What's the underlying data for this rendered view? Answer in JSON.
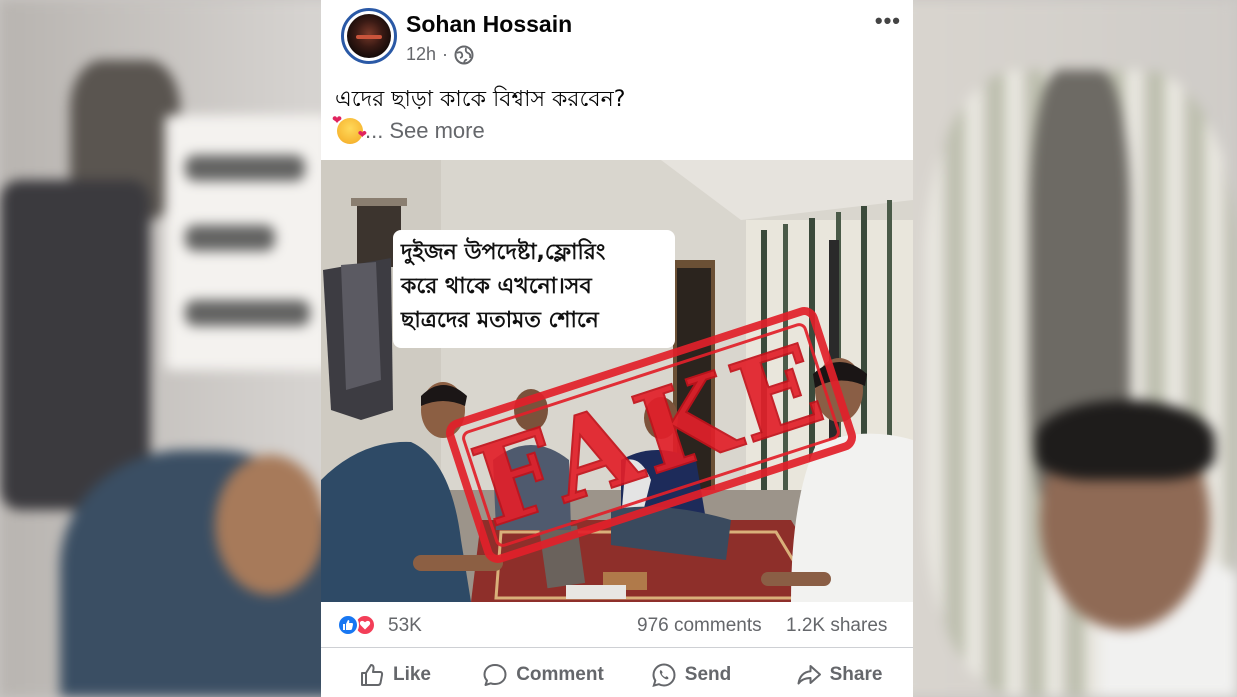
{
  "post": {
    "author": "Sohan Hossain",
    "time": "12h",
    "separator": "·",
    "privacy_icon": "globe-icon",
    "caption": "এদের ছাড়া কাকে বিশ্বাস করবেন?",
    "ellipsis": "...",
    "see_more": "See more",
    "more_icon": "•••"
  },
  "photo": {
    "overlay_lines": [
      "দুইজন উপদেষ্টা,ফ্লোরিং",
      "করে থাকে এখনো।সব",
      "ছাত্রদের মতামত শোনে"
    ],
    "stamp_text": "FAKE"
  },
  "stats": {
    "reactions": "53K",
    "comments": "976 comments",
    "shares": "1.2K shares"
  },
  "actions": {
    "like": "Like",
    "comment": "Comment",
    "send": "Send",
    "share": "Share"
  },
  "colors": {
    "stamp": "#e2202a",
    "like_blue": "#1877f2",
    "love_red": "#f33e58"
  }
}
